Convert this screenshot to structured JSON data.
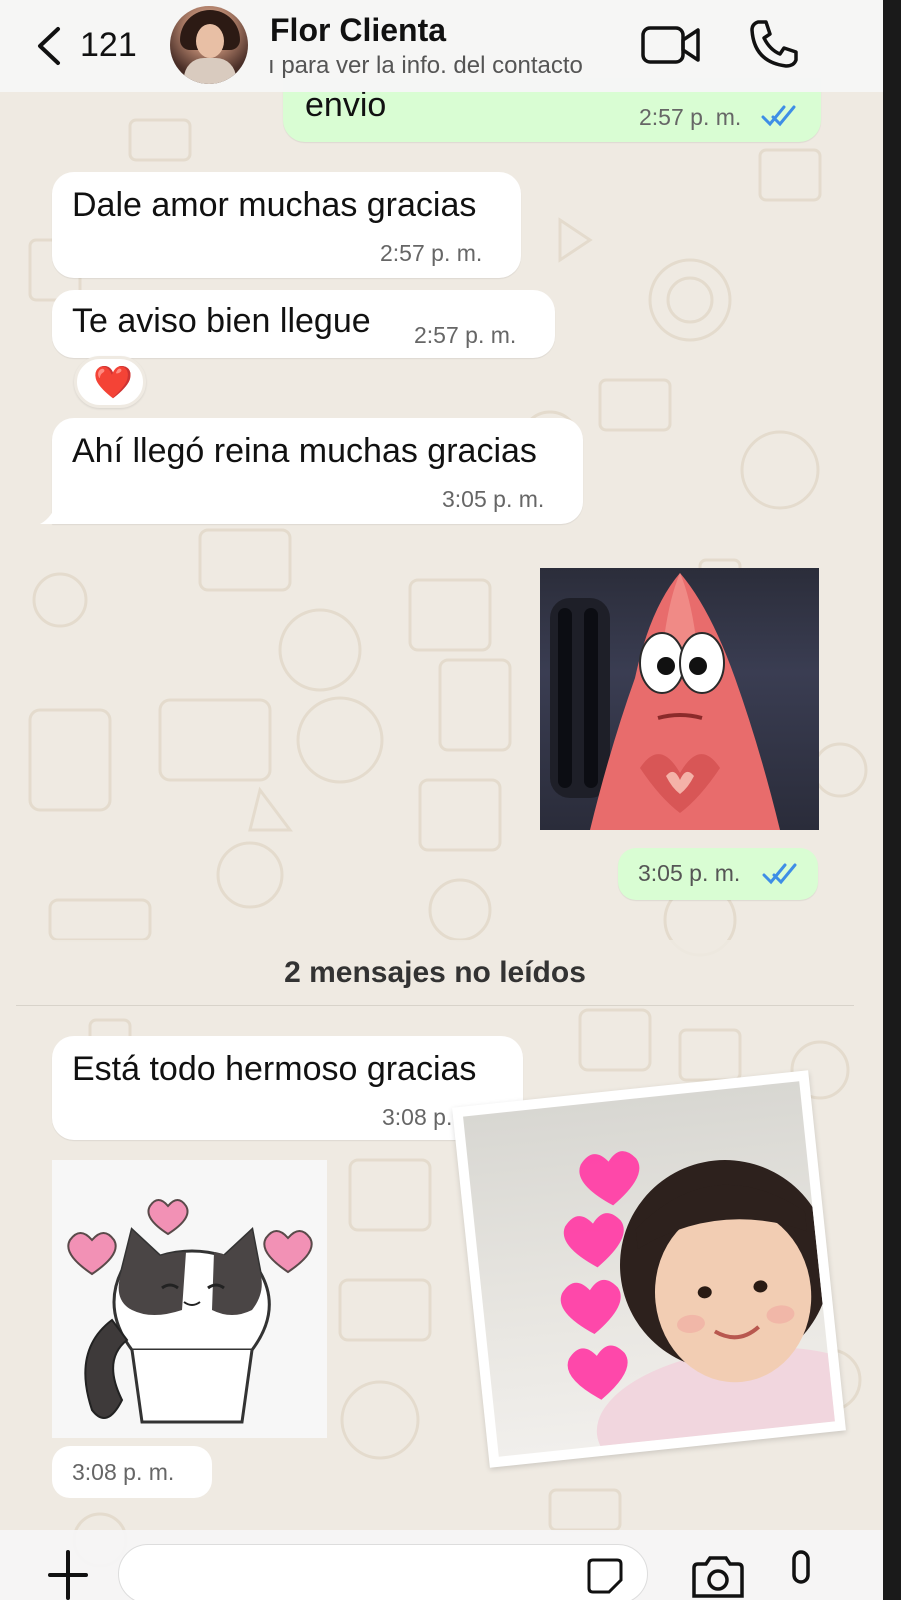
{
  "header": {
    "back_count": "121",
    "contact_name": "Flor Clienta",
    "contact_subtitle": "ı para ver la info. del contacto"
  },
  "messages": [
    {
      "direction": "outgoing",
      "text": "envio",
      "time": "2:57 p. m.",
      "status": "read"
    },
    {
      "direction": "incoming",
      "text": "Dale amor muchas gracias",
      "time": "2:57 p. m."
    },
    {
      "direction": "incoming",
      "text": "Te aviso bien llegue",
      "time": "2:57 p. m.",
      "reaction": "❤️"
    },
    {
      "direction": "incoming",
      "text": "Ahí llegó reina muchas gracias",
      "time": "3:05 p. m."
    },
    {
      "direction": "outgoing",
      "type": "sticker",
      "time": "3:05 p. m.",
      "status": "read"
    },
    {
      "direction": "incoming",
      "text": "Está todo hermoso gracias",
      "time": "3:08 p. m."
    },
    {
      "direction": "incoming",
      "type": "sticker",
      "time": "3:08 p. m."
    },
    {
      "direction": "incoming",
      "type": "sticker"
    }
  ],
  "unread_divider": "2 mensajes no leídos",
  "colors": {
    "incoming_bubble": "#ffffff",
    "outgoing_bubble": "#d9fdd3",
    "read_ticks": "#3e8ee6",
    "chat_background": "#efeae2",
    "header_background": "#f6f6f6"
  },
  "icons": {
    "back": "chevron-left-icon",
    "video": "video-camera-icon",
    "call": "phone-icon",
    "plus": "plus-icon",
    "sticker": "sticker-icon",
    "camera": "camera-icon",
    "mic": "microphone-icon"
  }
}
